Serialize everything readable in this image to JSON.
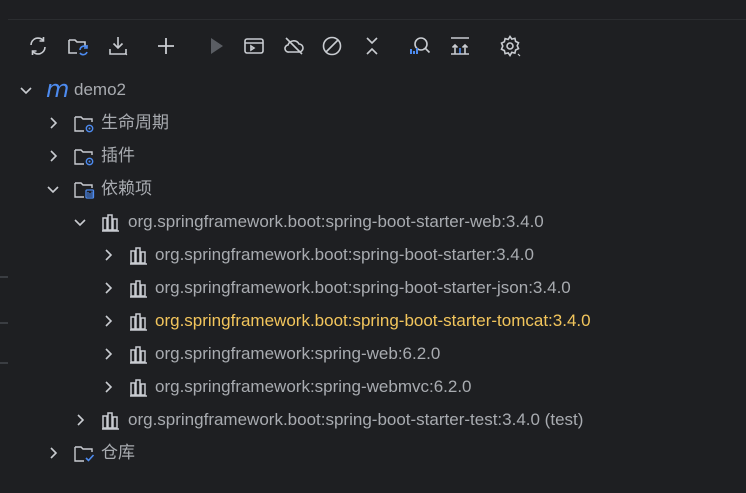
{
  "toolbar": {
    "buttons": [
      {
        "icon": "reload-icon"
      },
      {
        "icon": "reload-folder-icon"
      },
      {
        "icon": "download-icon"
      },
      {
        "icon": "add-icon"
      },
      {
        "icon": "run-icon"
      },
      {
        "icon": "execute-goal-icon"
      },
      {
        "icon": "offline-mode-icon"
      },
      {
        "icon": "skip-tests-icon"
      },
      {
        "icon": "collapse-icon"
      },
      {
        "icon": "analyze-dependencies-icon"
      },
      {
        "icon": "show-diagram-icon"
      },
      {
        "icon": "settings-icon"
      }
    ]
  },
  "tree": {
    "project": {
      "icon_glyph": "m",
      "label": "demo2"
    },
    "lifecycle": {
      "label": "生命周期"
    },
    "plugins": {
      "label": "插件"
    },
    "dependencies": {
      "label": "依赖项"
    },
    "dep_web": {
      "label": "org.springframework.boot:spring-boot-starter-web:3.4.0"
    },
    "dep_web_children": [
      {
        "label": "org.springframework.boot:spring-boot-starter:3.4.0",
        "highlight": false
      },
      {
        "label": "org.springframework.boot:spring-boot-starter-json:3.4.0",
        "highlight": false
      },
      {
        "label": "org.springframework.boot:spring-boot-starter-tomcat:3.4.0",
        "highlight": true
      },
      {
        "label": "org.springframework:spring-web:6.2.0",
        "highlight": false
      },
      {
        "label": "org.springframework:spring-webmvc:6.2.0",
        "highlight": false
      }
    ],
    "dep_test": {
      "label": "org.springframework.boot:spring-boot-starter-test:3.4.0 (test)"
    },
    "repositories": {
      "label": "仓库"
    }
  },
  "colors": {
    "background": "#1e1f22",
    "text": "#a8abb0",
    "highlight_text": "#f2c55c",
    "accent_blue": "#4d8bf0"
  }
}
